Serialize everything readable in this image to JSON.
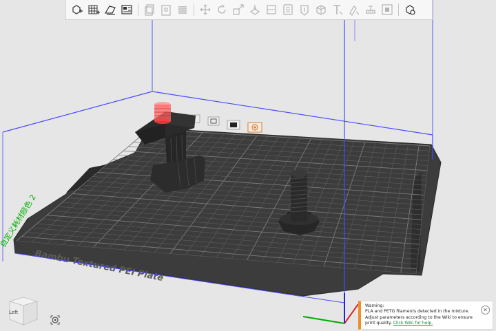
{
  "toolbar": {
    "buttons": [
      {
        "name": "add-object",
        "icon": "cube-plus-icon",
        "enabled": true
      },
      {
        "name": "add-plate",
        "icon": "grid-plus-icon",
        "enabled": true
      },
      {
        "name": "auto-orient",
        "icon": "orient-icon",
        "enabled": true
      },
      {
        "name": "arrange",
        "icon": "arrange-icon",
        "enabled": true
      },
      {
        "name": "copy",
        "icon": "copy-icon",
        "enabled": false
      },
      {
        "name": "paste",
        "icon": "paste-icon",
        "enabled": false
      },
      {
        "name": "layers",
        "icon": "layers-icon",
        "enabled": false
      },
      {
        "name": "move",
        "icon": "move-icon",
        "enabled": false
      },
      {
        "name": "rotate",
        "icon": "rotate-icon",
        "enabled": false
      },
      {
        "name": "scale",
        "icon": "scale-icon",
        "enabled": false
      },
      {
        "name": "lay-on-face",
        "icon": "lay-on-face-icon",
        "enabled": false
      },
      {
        "name": "cut",
        "icon": "cut-icon",
        "enabled": false
      },
      {
        "name": "support-paint",
        "icon": "support-paint-icon",
        "enabled": false
      },
      {
        "name": "seam-paint",
        "icon": "seam-paint-icon",
        "enabled": false
      },
      {
        "name": "boolean",
        "icon": "boolean-icon",
        "enabled": false
      },
      {
        "name": "text",
        "icon": "text-icon",
        "enabled": false
      },
      {
        "name": "color-paint",
        "icon": "color-paint-icon",
        "enabled": false
      },
      {
        "name": "measure",
        "icon": "measure-icon",
        "enabled": false
      },
      {
        "name": "assembly",
        "icon": "assembly-icon",
        "enabled": false
      },
      {
        "name": "view-settings",
        "icon": "view-settings-icon",
        "enabled": true
      }
    ]
  },
  "plate": {
    "name_text": "Bambu Textured PEI Plate",
    "side_text": "自定义耗材颜色 2"
  },
  "view_cube": {
    "face_label": "Left"
  },
  "warning": {
    "title": "Warning:",
    "line1": "PLA and PETG filaments detected in the mixture.",
    "line2": "Adjust parameters according to the Wiki to ensure",
    "line3_prefix": "print quality.",
    "link_text": "Click Wiki for help.",
    "close_symbol": "✕"
  },
  "colors": {
    "background": "#e6e6e6",
    "plate": "#3a3a3a",
    "grid_line": "#6a6a6a",
    "bounding_box": "#4a4aff",
    "objects": "#2a2a2a",
    "label_green": "#00b000",
    "warning_accent": "#f28c28",
    "link_green": "#0a8a3a"
  }
}
